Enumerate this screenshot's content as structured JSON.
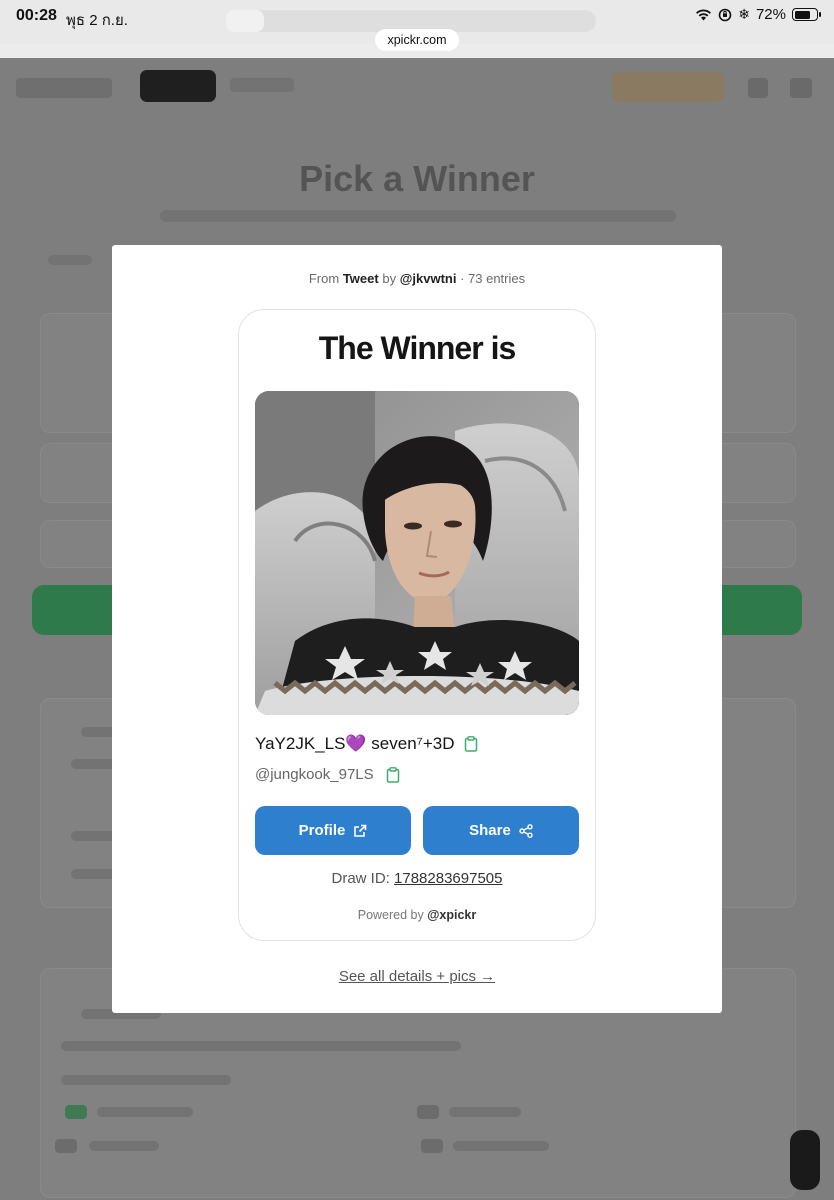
{
  "status_bar": {
    "time": "00:28",
    "date": "พุธ 2 ก.ย.",
    "battery": "72%",
    "battery_level": 0.72
  },
  "browser": {
    "url": "xpickr.com"
  },
  "background_page": {
    "title": "Pick a Winner"
  },
  "modal": {
    "source": {
      "prefix": "From",
      "type": "Tweet",
      "by": "by",
      "author": "@jkvwtni",
      "entries": "· 73 entries"
    },
    "card": {
      "heading": "The Winner is",
      "winner": {
        "display_name": "YaY2JK_LS💜 seven⁷+3D",
        "handle": "@jungkook_97LS"
      },
      "buttons": {
        "profile": "Profile",
        "share": "Share"
      },
      "draw_id_label": "Draw ID:",
      "draw_id": "1788283697505",
      "powered_prefix": "Powered by",
      "powered_brand": "@xpickr"
    },
    "details_link": "See all details + pics →"
  },
  "colors": {
    "primary_button": "#2f7fcf",
    "copy_icon": "#3fae6a",
    "overlay": "#7e7e7e"
  },
  "icons": [
    "wifi-icon",
    "orientation-lock-icon",
    "snowflake-icon",
    "battery-icon",
    "copy-icon",
    "external-link-icon",
    "share-icon"
  ]
}
